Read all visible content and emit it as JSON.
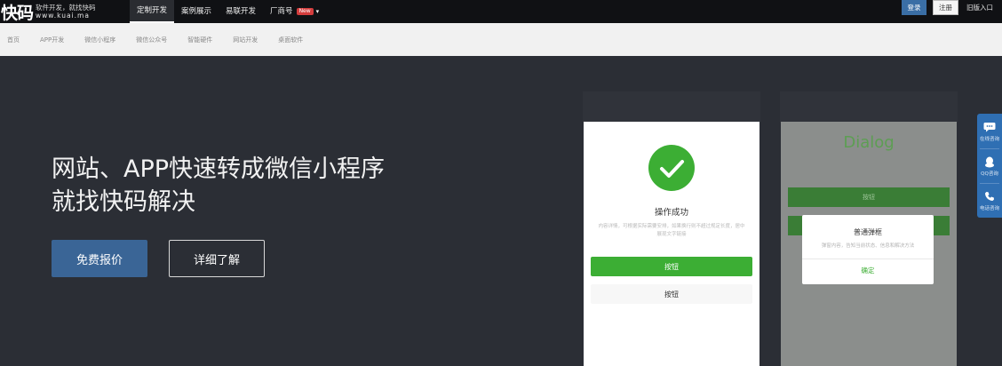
{
  "brand": {
    "logo_text": "快码",
    "tagline": "软件开发，就找快码",
    "url": "www.kuai.ma"
  },
  "topnav": {
    "items": [
      {
        "label": "定制开发",
        "active": true
      },
      {
        "label": "案例展示",
        "active": false
      },
      {
        "label": "易联开发",
        "active": false
      },
      {
        "label": "厂商号",
        "active": false,
        "badge": "New",
        "dropdown": true
      }
    ],
    "login_label": "登录",
    "register_label": "注册",
    "entry_label": "旧版入口"
  },
  "subnav": {
    "items": [
      "首页",
      "APP开发",
      "微信小程序",
      "微信公众号",
      "智能硬件",
      "网站开发",
      "桌面软件"
    ]
  },
  "hero": {
    "title_line1": "网站、APP快速转成微信小程序",
    "title_line2": "就找快码解决",
    "primary_button": "免费报价",
    "secondary_button": "详细了解"
  },
  "phone_success": {
    "title": "操作成功",
    "description": "内容详情，可根据实际需要安排，如果换行则不超过规定长度，居中展现文字链接",
    "primary_button": "按钮",
    "secondary_button": "按钮"
  },
  "phone_dialog": {
    "title": "Dialog",
    "bar_label": "按钮",
    "dialog_title": "普通弹框",
    "dialog_desc": "弹窗内容，告知当前状态、信息和解决方法",
    "dialog_button": "确定"
  },
  "side_tools": {
    "items": [
      {
        "icon": "chat-bubble-icon",
        "label": "在线咨询"
      },
      {
        "icon": "qq-penguin-icon",
        "label": "QQ咨询"
      },
      {
        "icon": "phone-icon",
        "label": "电话咨询"
      }
    ]
  },
  "colors": {
    "topbar": "#101114",
    "hero_bg": "#2b2e35",
    "accent_blue": "#3a6596",
    "success_green": "#3cae34",
    "side_blue": "#2f6fb3"
  }
}
